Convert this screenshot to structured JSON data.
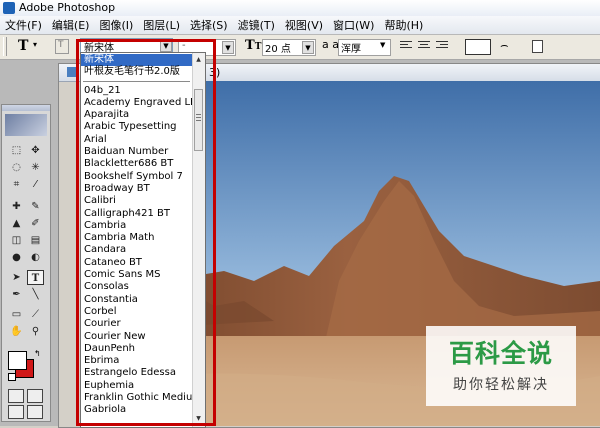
{
  "window": {
    "title": "Adobe Photoshop"
  },
  "menu": [
    "文件(F)",
    "编辑(E)",
    "图像(I)",
    "图层(L)",
    "选择(S)",
    "滤镜(T)",
    "视图(V)",
    "窗口(W)",
    "帮助(H)"
  ],
  "options_bar": {
    "tool_glyph": "T",
    "font_family": "新宋体",
    "font_style": "-",
    "font_size": "20 点",
    "aa_label": "a a",
    "anti_alias": "浑厚"
  },
  "document": {
    "title_suffix": "3)"
  },
  "font_list": {
    "recent": [
      "新宋体",
      "叶根友毛笔行书2.0版"
    ],
    "fonts": [
      "04b_21",
      "Academy Engraved LET",
      "Aparajita",
      "Arabic Typesetting",
      "Arial",
      "Baiduan Number",
      "Blackletter686 BT",
      "Bookshelf Symbol 7",
      "Broadway BT",
      "Calibri",
      "Calligraph421 BT",
      "Cambria",
      "Cambria Math",
      "Candara",
      "Cataneo BT",
      "Comic Sans MS",
      "Consolas",
      "Constantia",
      "Corbel",
      "Courier",
      "Courier New",
      "DaunPenh",
      "Ebrima",
      "Estrangelo Edessa",
      "Euphemia",
      "Franklin Gothic Medium",
      "Gabriola"
    ],
    "selected_index": 0
  },
  "watermark": {
    "title": "百科全说",
    "subtitle": "助你轻松解决"
  },
  "colors": {
    "highlight": "#c40000",
    "selection": "#316ac5",
    "foreground": "#ffffff",
    "background": "#d01818",
    "watermark_green": "#2c9a46"
  },
  "icons": [
    "photoshop-icon",
    "type-tool-icon",
    "font-size-icon",
    "anti-alias-icon",
    "align-left-icon",
    "align-center-icon",
    "align-right-icon",
    "warp-text-icon",
    "palettes-icon"
  ]
}
